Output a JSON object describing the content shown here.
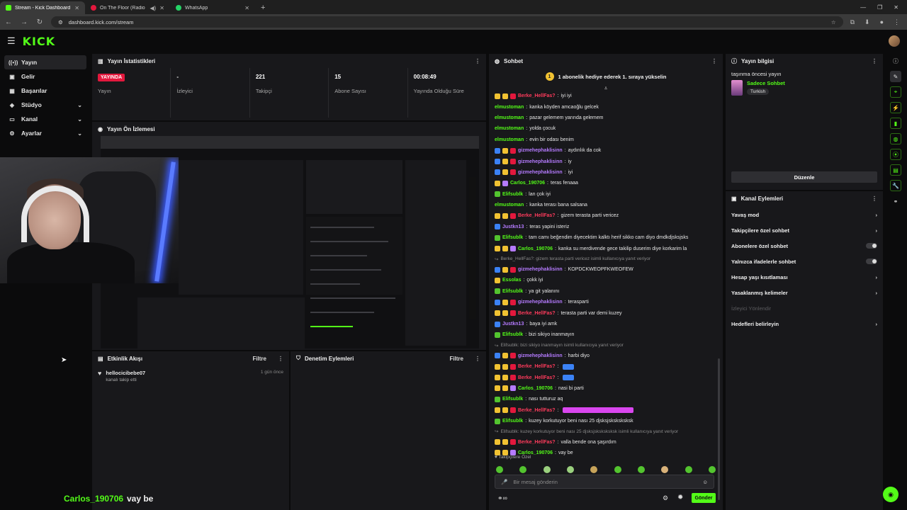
{
  "browser": {
    "tabs": [
      {
        "title": "Stream - Kick Dashboard",
        "favicon_color": "#53fc18",
        "active": true
      },
      {
        "title": "On The Floor (Radio Edit)",
        "favicon_color": "#e3183d",
        "active": false
      },
      {
        "title": "WhatsApp",
        "favicon_color": "#25d366",
        "active": false
      }
    ],
    "url": "dashboard.kick.com/stream"
  },
  "app": {
    "logo": "KICK"
  },
  "sidebar": {
    "items": [
      {
        "label": "Yayın",
        "icon": "broadcast-icon",
        "glyph": "((•))",
        "active": true,
        "chevron": false
      },
      {
        "label": "Gelir",
        "icon": "revenue-icon",
        "glyph": "▣",
        "active": false,
        "chevron": false
      },
      {
        "label": "Başarılar",
        "icon": "achievements-icon",
        "glyph": "▦",
        "active": false,
        "chevron": false
      },
      {
        "label": "Stüdyo",
        "icon": "studio-icon",
        "glyph": "◈",
        "active": false,
        "chevron": true
      },
      {
        "label": "Kanal",
        "icon": "channel-icon",
        "glyph": "▭",
        "active": false,
        "chevron": true
      },
      {
        "label": "Ayarlar",
        "icon": "settings-icon",
        "glyph": "⚙",
        "active": false,
        "chevron": true
      }
    ]
  },
  "stats_panel": {
    "title": "Yayın İstatistikleri",
    "live_badge": "YAYINDA",
    "stats": [
      {
        "value": "",
        "label": "Yayın"
      },
      {
        "value": "-",
        "label": "İzleyici"
      },
      {
        "value": "221",
        "label": "Takipçi"
      },
      {
        "value": "15",
        "label": "Abone Sayısı"
      },
      {
        "value": "00:08:49",
        "label": "Yayında Olduğu Süre"
      }
    ]
  },
  "preview_panel": {
    "title": "Yayın Ön İzlemesi"
  },
  "activity_panel": {
    "title": "Etkinlik Akışı",
    "filter_label": "Filtre",
    "event": {
      "user": "hellocicibebe07",
      "text": "kanalı takip etti",
      "time": "1 gün önce"
    }
  },
  "moderation_panel": {
    "title": "Denetim Eylemleri",
    "filter_label": "Filtre"
  },
  "chat": {
    "title": "Sohbet",
    "banner": "1 abonelik hediye ederek 1. sıraya yükselin",
    "banner_count": "1",
    "messages": [
      {
        "user": "Berke_HellFas?",
        "color": "#ff3b5c",
        "text": "iyi iyi",
        "badges": [
          "#f1c232",
          "#f1c232",
          "#e3183d"
        ]
      },
      {
        "user": "elmustoman",
        "color": "#53fc18",
        "text": "kanka köyden amcaoğlu gelcek",
        "badges": []
      },
      {
        "user": "elmustoman",
        "color": "#53fc18",
        "text": "pazar gelemem yarında gelemem",
        "badges": []
      },
      {
        "user": "elmustoman",
        "color": "#53fc18",
        "text": "yolda çocuk",
        "badges": []
      },
      {
        "user": "elmustoman",
        "color": "#53fc18",
        "text": "evin bir odası benim",
        "badges": []
      },
      {
        "user": "gizmehephaklisinn",
        "color": "#b57bff",
        "text": "aydınlık da cok",
        "badges": [
          "#3b82f6",
          "#f1c232",
          "#e3183d"
        ]
      },
      {
        "user": "gizmehephaklisinn",
        "color": "#b57bff",
        "text": "iy",
        "badges": [
          "#3b82f6",
          "#f1c232",
          "#e3183d"
        ]
      },
      {
        "user": "gizmehephaklisinn",
        "color": "#b57bff",
        "text": "iyi",
        "badges": [
          "#3b82f6",
          "#f1c232",
          "#e3183d"
        ]
      },
      {
        "user": "Carlos_190706",
        "color": "#53fc18",
        "text": "teras fenaaa",
        "badges": [
          "#f1c232",
          "#b57bff"
        ]
      },
      {
        "user": "Elifsublk",
        "color": "#53fc18",
        "text": "lan çok iyi",
        "badges": [
          "#53c42f"
        ]
      },
      {
        "user": "elmustoman",
        "color": "#53fc18",
        "text": "kanka terası bana salsana",
        "badges": []
      },
      {
        "user": "Berke_HellFas?",
        "color": "#ff3b5c",
        "text": "gizem terasta parti vericez",
        "badges": [
          "#f1c232",
          "#f1c232",
          "#e3183d"
        ]
      },
      {
        "user": "Justkn13",
        "color": "#b57bff",
        "text": "teras yapini isteriz",
        "badges": [
          "#3b82f6"
        ]
      },
      {
        "user": "Elifsublk",
        "color": "#53fc18",
        "text": "tam camı beğendim diyecektim kalktı herif sikko cam diyo dmdkdjsksjsks",
        "badges": [
          "#53c42f"
        ]
      },
      {
        "user": "Carlos_190706",
        "color": "#53fc18",
        "text": "kanka su merdivende gece takilip duserim diye korkarim la",
        "badges": [
          "#f1c232",
          "#f1c232",
          "#b57bff"
        ]
      },
      {
        "reply": "Berke_HellFas?: gizem terasta parti vericez isimli kullanıcıya yanıt veriyor"
      },
      {
        "user": "gizmehephaklisinn",
        "color": "#b57bff",
        "text": "KOPDCKWEOPFKWEOFEW",
        "badges": [
          "#3b82f6",
          "#f1c232",
          "#e3183d"
        ]
      },
      {
        "user": "Essolas",
        "color": "#53fc18",
        "text": "çokk iyi",
        "badges": [
          "#f1c232"
        ]
      },
      {
        "user": "Elifsublk",
        "color": "#53fc18",
        "text": "ya git yalanını",
        "badges": [
          "#53c42f"
        ]
      },
      {
        "user": "gizmehephaklisinn",
        "color": "#b57bff",
        "text": "terasparti",
        "badges": [
          "#3b82f6",
          "#f1c232",
          "#e3183d"
        ]
      },
      {
        "user": "Berke_HellFas?",
        "color": "#ff3b5c",
        "text": "terasta parti var demi kuzey",
        "badges": [
          "#f1c232",
          "#f1c232",
          "#e3183d"
        ]
      },
      {
        "user": "Justkn13",
        "color": "#b57bff",
        "text": "baya iyi amk",
        "badges": [
          "#3b82f6"
        ]
      },
      {
        "user": "Elifsublk",
        "color": "#53fc18",
        "text": "bizi sikiyo inanmayın",
        "badges": [
          "#53c42f"
        ]
      },
      {
        "reply": "Elifsublk: bizi sikiyo inanmayın isimli kullanıcıya yanıt veriyor"
      },
      {
        "user": "gizmehephaklisinn",
        "color": "#b57bff",
        "text": "harbi diyo",
        "badges": [
          "#3b82f6",
          "#f1c232",
          "#e3183d"
        ]
      },
      {
        "user": "Berke_HellFas?",
        "color": "#ff3b5c",
        "text": "",
        "badges": [
          "#f1c232",
          "#f1c232",
          "#e3183d"
        ]
      },
      {
        "user": "Berke_HellFas?",
        "color": "#ff3b5c",
        "text": "",
        "badges": [
          "#f1c232",
          "#f1c232",
          "#e3183d"
        ]
      },
      {
        "user": "Carlos_190706",
        "color": "#53fc18",
        "text": "nasi bi parti",
        "badges": [
          "#f1c232",
          "#f1c232",
          "#b57bff"
        ]
      },
      {
        "user": "Elifsublk",
        "color": "#53fc18",
        "text": "nası tutturuz aq",
        "badges": [
          "#53c42f"
        ]
      },
      {
        "user": "Berke_HellFas?",
        "color": "#ff3b5c",
        "text": "",
        "badges": [
          "#f1c232",
          "#f1c232",
          "#e3183d"
        ]
      },
      {
        "user": "Elifsublk",
        "color": "#53fc18",
        "text": "kuzey korkutuyor beni nası 25 djsksjsksksksksk",
        "badges": [
          "#53c42f"
        ]
      },
      {
        "reply": "Elifsublk: kuzey korkutuyor beni nası 25 djsksjsksksksksk isimli kullanıcıya yanıt veriyor"
      },
      {
        "user": "Berke_HellFas?",
        "color": "#ff3b5c",
        "text": "valla bende ona şaşırdım",
        "badges": [
          "#f1c232",
          "#f1c232",
          "#e3183d"
        ]
      },
      {
        "user": "Carlos_190706",
        "color": "#53fc18",
        "text": "vay be",
        "badges": [
          "#f1c232",
          "#f1c232",
          "#b57bff"
        ]
      }
    ],
    "followers_only_label": "Takipçilere Özel",
    "input_placeholder": "Bir mesaj gönderin",
    "send_label": "Gönder"
  },
  "stream_info": {
    "title": "Yayın bilgisi",
    "stream_title": "taşınma öncesi yayın",
    "category": "Sadece Sohbet",
    "language_tag": "Turkish",
    "edit_label": "Düzenle"
  },
  "channel_actions": {
    "title": "Kanal Eylemleri",
    "items": [
      {
        "label": "Yavaş mod",
        "type": "chevron"
      },
      {
        "label": "Takipçilere özel sohbet",
        "type": "chevron"
      },
      {
        "label": "Abonelere özel sohbet",
        "type": "toggle"
      },
      {
        "label": "Yalnızca ifadelerle sohbet",
        "type": "toggle"
      },
      {
        "label": "Hesap yaşı kısıtlaması",
        "type": "chevron"
      },
      {
        "label": "Yasaklanmış kelimeler",
        "type": "chevron"
      },
      {
        "label": "İzleyici Yönlendir",
        "type": "dim"
      },
      {
        "label": "Hedefleri belirleyin",
        "type": "chevron"
      }
    ]
  },
  "overlay": {
    "user": "Carlos_190706",
    "text": "vay be"
  },
  "colors": {
    "accent": "#53fc18",
    "live": "#e3183d",
    "panel": "#18181b",
    "bg": "#0b0b0c"
  }
}
